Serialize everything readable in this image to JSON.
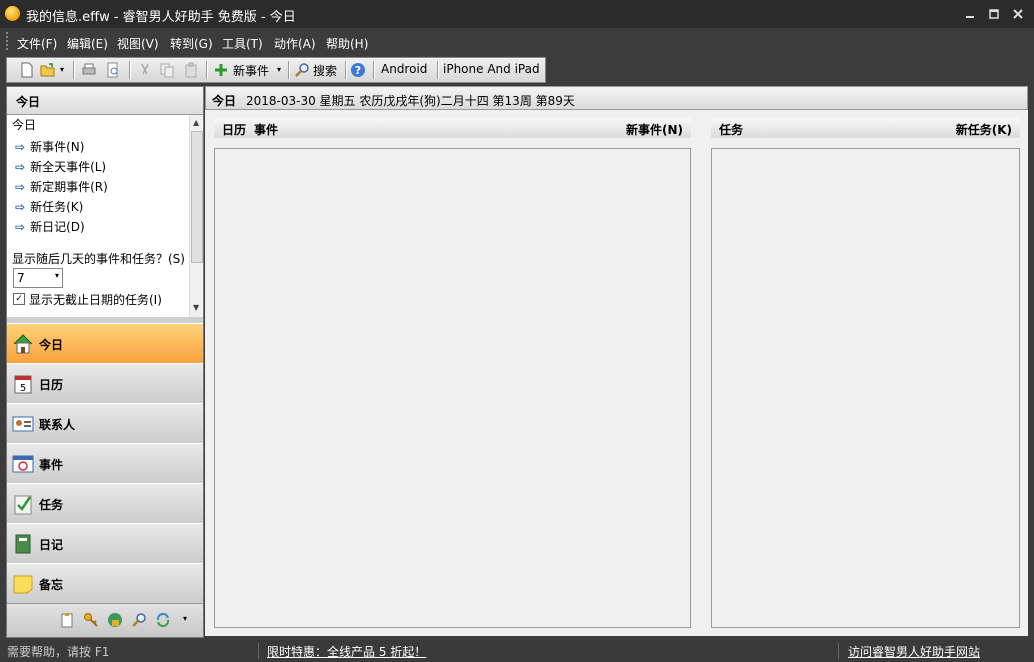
{
  "window": {
    "title": "我的信息.effw - 睿智男人好助手 免费版 - 今日",
    "minimize_icon": "minimize-icon",
    "maximize_icon": "maximize-icon",
    "close_icon": "close-icon"
  },
  "menu": [
    "文件(F)",
    "编辑(E)",
    "视图(V)",
    "转到(G)",
    "工具(T)",
    "动作(A)",
    "帮助(H)"
  ],
  "toolbar": {
    "new_event_label": "新事件",
    "search_label": "搜索",
    "android_label": "Android",
    "iphone_label": "iPhone And iPad"
  },
  "left_panel": {
    "header": "今日",
    "section_title": "今日",
    "links": [
      "新事件(N)",
      "新全天事件(L)",
      "新定期事件(R)",
      "新任务(K)",
      "新日记(D)"
    ],
    "days_prompt": "显示随后几天的事件和任务？(S)",
    "days_value": "7",
    "show_nodue_label": "显示无截止日期的任务(I)",
    "show_nodue_checked": true
  },
  "nav": [
    "今日",
    "日历",
    "联系人",
    "事件",
    "任务",
    "日记",
    "备忘"
  ],
  "content": {
    "date_label": "今日",
    "date_text": "2018-03-30 星期五 农历戊戌年(狗)二月十四  第13周 第89天",
    "left_pane": {
      "col1": "日历",
      "col2": "事件",
      "action": "新事件(N)"
    },
    "right_pane": {
      "col1": "任务",
      "action": "新任务(K)"
    }
  },
  "statusbar": {
    "help": "需要帮助，请按 F1",
    "promo": "限时特惠：全线产品 5 折起！",
    "visit": "访问睿智男人好助手网站"
  }
}
